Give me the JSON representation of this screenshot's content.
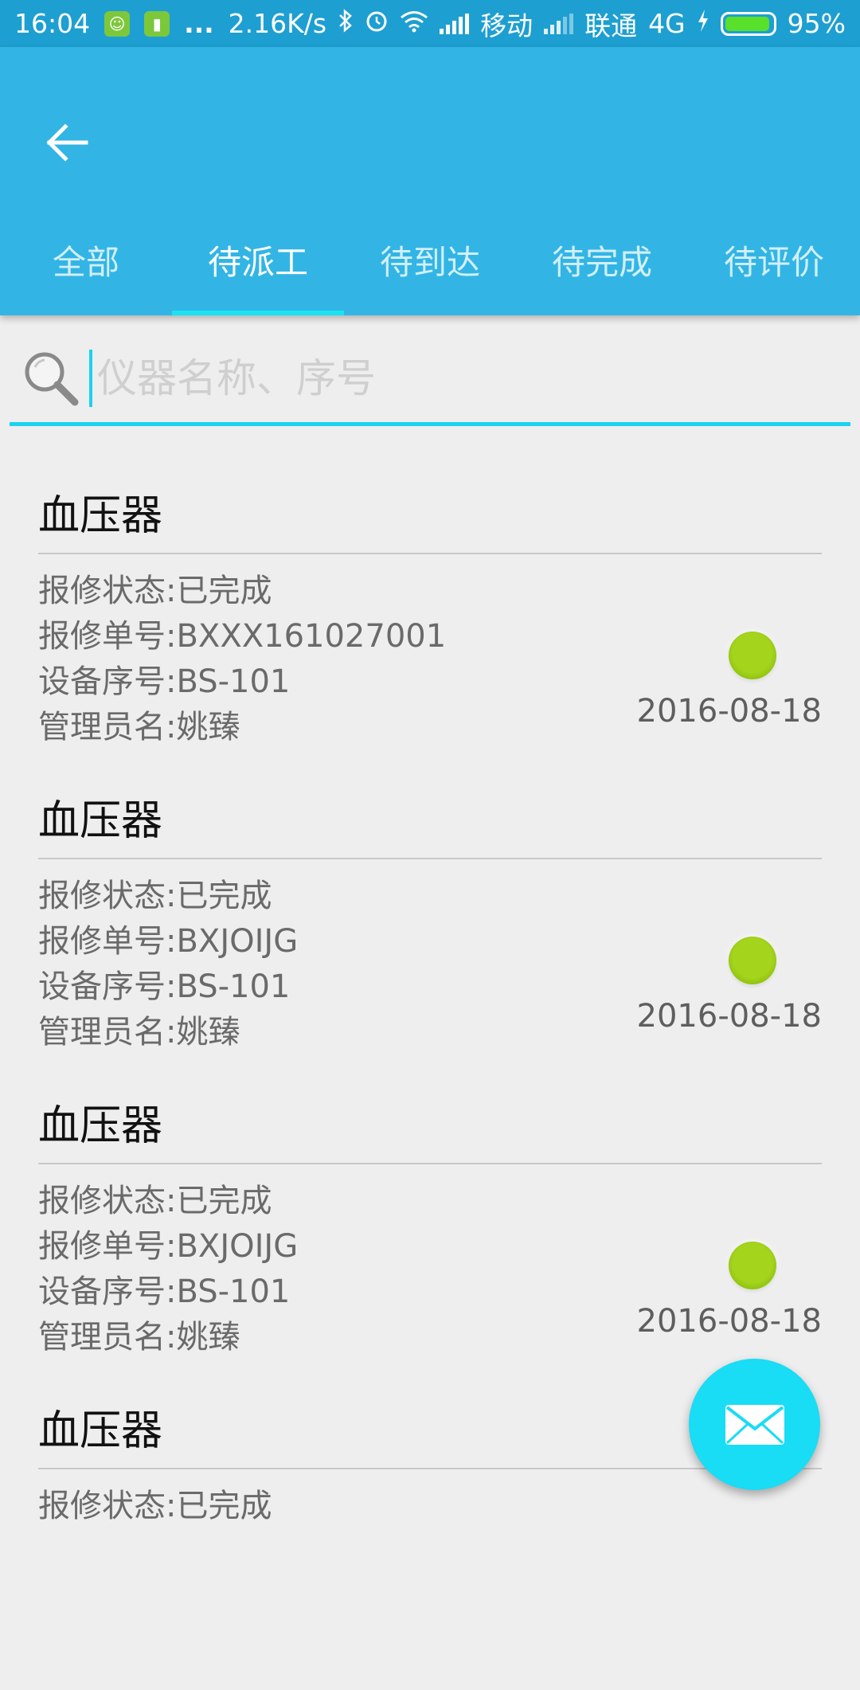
{
  "status_bar": {
    "time": "16:04",
    "more": "...",
    "net_speed": "2.16K/s",
    "carrier1": "移动",
    "carrier2": "联通",
    "network": "4G",
    "battery_percent": "95%",
    "battery_level": 0.95,
    "icons": [
      "android-app-icon",
      "battery-app-icon",
      "bluetooth-icon",
      "alarm-icon",
      "wifi-icon",
      "signal-icon",
      "charging-icon",
      "battery-icon"
    ]
  },
  "toolbar": {
    "back_icon": "back-arrow-icon",
    "tabs": [
      {
        "label": "全部",
        "active": false
      },
      {
        "label": "待派工",
        "active": true
      },
      {
        "label": "待到达",
        "active": false
      },
      {
        "label": "待完成",
        "active": false
      },
      {
        "label": "待评价",
        "active": false
      }
    ]
  },
  "search": {
    "placeholder": "仪器名称、序号",
    "value": "",
    "icon": "search-icon"
  },
  "items": [
    {
      "title": "血压器",
      "status": "报修状态:已完成",
      "order": "报修单号:BXXX161027001",
      "serial": "设备序号:BS-101",
      "admin": "管理员名:姚臻",
      "date": "2016-08-18"
    },
    {
      "title": "血压器",
      "status": "报修状态:已完成",
      "order": "报修单号:BXJOIJG",
      "serial": "设备序号:BS-101",
      "admin": "管理员名:姚臻",
      "date": "2016-08-18"
    },
    {
      "title": "血压器",
      "status": "报修状态:已完成",
      "order": "报修单号:BXJOIJG",
      "serial": "设备序号:BS-101",
      "admin": "管理员名:姚臻",
      "date": "2016-08-18"
    },
    {
      "title": "血压器",
      "status": "报修状态:已完成",
      "order": "",
      "serial": "",
      "admin": "",
      "date": ""
    }
  ],
  "fab": {
    "icon": "mail-icon"
  },
  "colors": {
    "status_bar": "#1d9fd1",
    "toolbar": "#32b5e5",
    "accent": "#19dcf5",
    "status_dot": "#a4d41c",
    "background": "#eeeeee"
  }
}
